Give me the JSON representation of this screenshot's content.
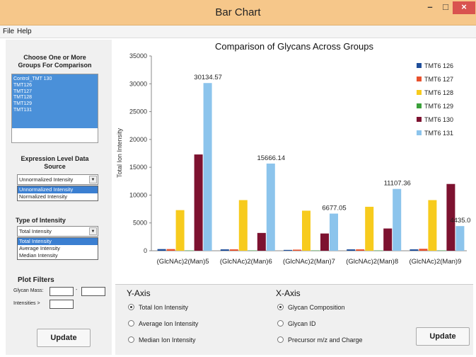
{
  "window": {
    "title": "Bar Chart",
    "min_glyph": "–",
    "max_glyph": "□",
    "close_glyph": "×"
  },
  "menu": {
    "file": "File",
    "help": "Help"
  },
  "left": {
    "groups_header": [
      "Choose One or More",
      "Groups For Comparison"
    ],
    "groups": [
      "Control_TMT 130",
      "TMT126",
      "TMT127",
      "TMT128",
      "TMT129",
      "TMT131"
    ],
    "expression_header": [
      "Expression Level Data",
      "Source"
    ],
    "expression_value": "Unnormalized Intensity",
    "expression_options": [
      "Unnormalized Intensity",
      "Normalized Intensity"
    ],
    "type_header": "Type of Intensity",
    "type_value": "Total Intensity",
    "type_options": [
      "Total Intensity",
      "Average Intensity",
      "Median Intensity"
    ],
    "plot_filters_header": "Plot Filters",
    "glycan_mass_label": "Glycan Mass:",
    "mass_dash": "-",
    "intensities_label": "Intensities >",
    "update_label": "Update"
  },
  "bottom": {
    "y_axis_title": "Y-Axis",
    "y_options": [
      "Total Ion Intensity",
      "Average Ion Intensity",
      "Median Ion Intensity"
    ],
    "y_selected": 0,
    "x_axis_title": "X-Axis",
    "x_options": [
      "Glycan Composition",
      "Glycan ID",
      "Precursor m/z and Charge"
    ],
    "x_selected": 0,
    "update_label": "Update"
  },
  "chart_data": {
    "type": "bar",
    "title": "Comparison of Glycans Across Groups",
    "ylabel": "Total Ion Intensity",
    "xlabel": "",
    "ylim": [
      0,
      35000
    ],
    "yticks": [
      0,
      5000,
      10000,
      15000,
      20000,
      25000,
      30000,
      35000
    ],
    "categories": [
      "(GlcNAc)2(Man)5",
      "(GlcNAc)2(Man)6",
      "(GlcNAc)2(Man)7",
      "(GlcNAc)2(Man)8",
      "(GlcNAc)2(Man)9"
    ],
    "series": [
      {
        "name": "TMT6 126",
        "color": "#1f4e9a",
        "values": [
          300,
          250,
          150,
          250,
          250
        ]
      },
      {
        "name": "TMT6 127",
        "color": "#e8512d",
        "values": [
          300,
          250,
          200,
          250,
          350
        ]
      },
      {
        "name": "TMT6 128",
        "color": "#f7cb1d",
        "values": [
          7300,
          9100,
          7200,
          7900,
          9100
        ]
      },
      {
        "name": "TMT6 129",
        "color": "#3aa03a",
        "values": [
          50,
          50,
          50,
          50,
          50
        ]
      },
      {
        "name": "TMT6 130",
        "color": "#7d1230",
        "values": [
          17300,
          3200,
          3100,
          4000,
          12000
        ]
      },
      {
        "name": "TMT6 131",
        "color": "#8cc4ec",
        "values": [
          30134.57,
          15666.14,
          6677.05,
          11107.36,
          4435.0
        ]
      }
    ],
    "data_labels": [
      "30134.57",
      "15666.14",
      "6677.05",
      "11107.36",
      "4435.0"
    ],
    "legend": "top-right",
    "grid": false
  }
}
